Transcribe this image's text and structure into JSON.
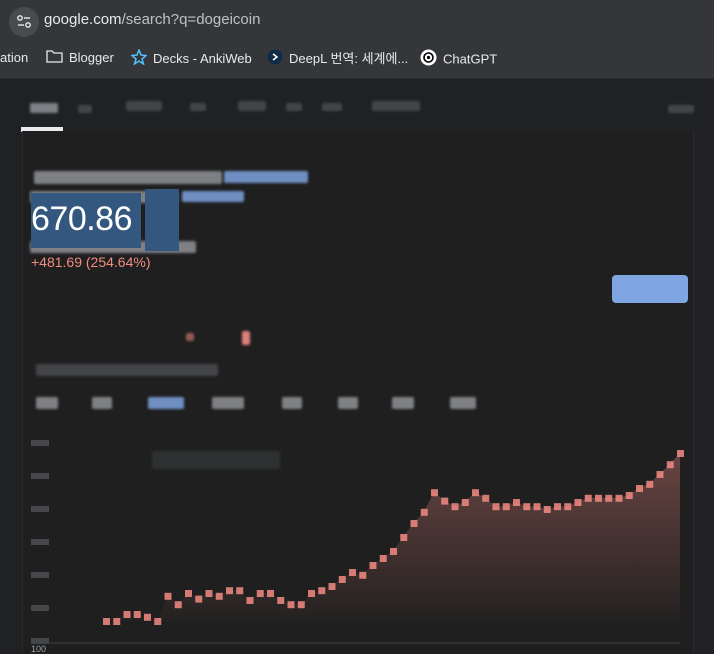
{
  "browser": {
    "url_domain": "google.com",
    "url_path": "/search?q=dogeicoin"
  },
  "bookmarks": [
    {
      "label": "ation",
      "icon": "none"
    },
    {
      "label": "Blogger",
      "icon": "folder-icon"
    },
    {
      "label": "Decks - AnkiWeb",
      "icon": "anki-star-icon"
    },
    {
      "label": "DeepL 번역: 세계에...",
      "icon": "deepl-icon"
    },
    {
      "label": "ChatGPT",
      "icon": "chatgpt-icon"
    }
  ],
  "stock": {
    "price": "670.86",
    "change": "+481.69 (254.64%)"
  },
  "chart_data": {
    "type": "line",
    "y_tick_labels": [
      "100"
    ],
    "values": [
      0,
      0,
      0.05,
      0.05,
      0.03,
      0,
      0.18,
      0.12,
      0.2,
      0.16,
      0.2,
      0.18,
      0.22,
      0.22,
      0.15,
      0.2,
      0.2,
      0.15,
      0.12,
      0.12,
      0.2,
      0.22,
      0.25,
      0.3,
      0.35,
      0.33,
      0.4,
      0.45,
      0.5,
      0.6,
      0.7,
      0.78,
      0.92,
      0.86,
      0.82,
      0.85,
      0.92,
      0.88,
      0.82,
      0.82,
      0.85,
      0.82,
      0.82,
      0.8,
      0.82,
      0.82,
      0.85,
      0.88,
      0.88,
      0.88,
      0.88,
      0.9,
      0.95,
      0.98,
      1.05,
      1.12,
      1.2
    ]
  },
  "colors": {
    "positive": "#f28b82",
    "accent": "#8ab4f8",
    "background": "#202124"
  }
}
